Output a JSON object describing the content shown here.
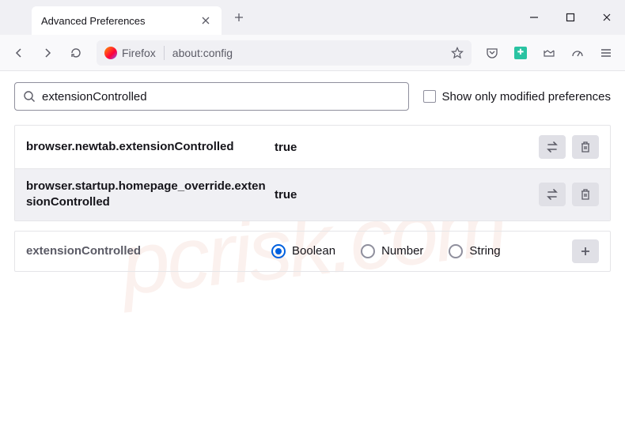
{
  "window": {
    "tab_title": "Advanced Preferences"
  },
  "urlbar": {
    "identity": "Firefox",
    "url": "about:config"
  },
  "search": {
    "value": "extensionControlled",
    "checkbox_label": "Show only modified preferences"
  },
  "prefs": [
    {
      "name": "browser.newtab.extensionControlled",
      "value": "true"
    },
    {
      "name": "browser.startup.homepage_override.extensionControlled",
      "value": "true"
    }
  ],
  "newpref": {
    "name": "extensionControlled",
    "types": [
      "Boolean",
      "Number",
      "String"
    ],
    "selected": 0
  },
  "watermark": "pcrisk.com"
}
